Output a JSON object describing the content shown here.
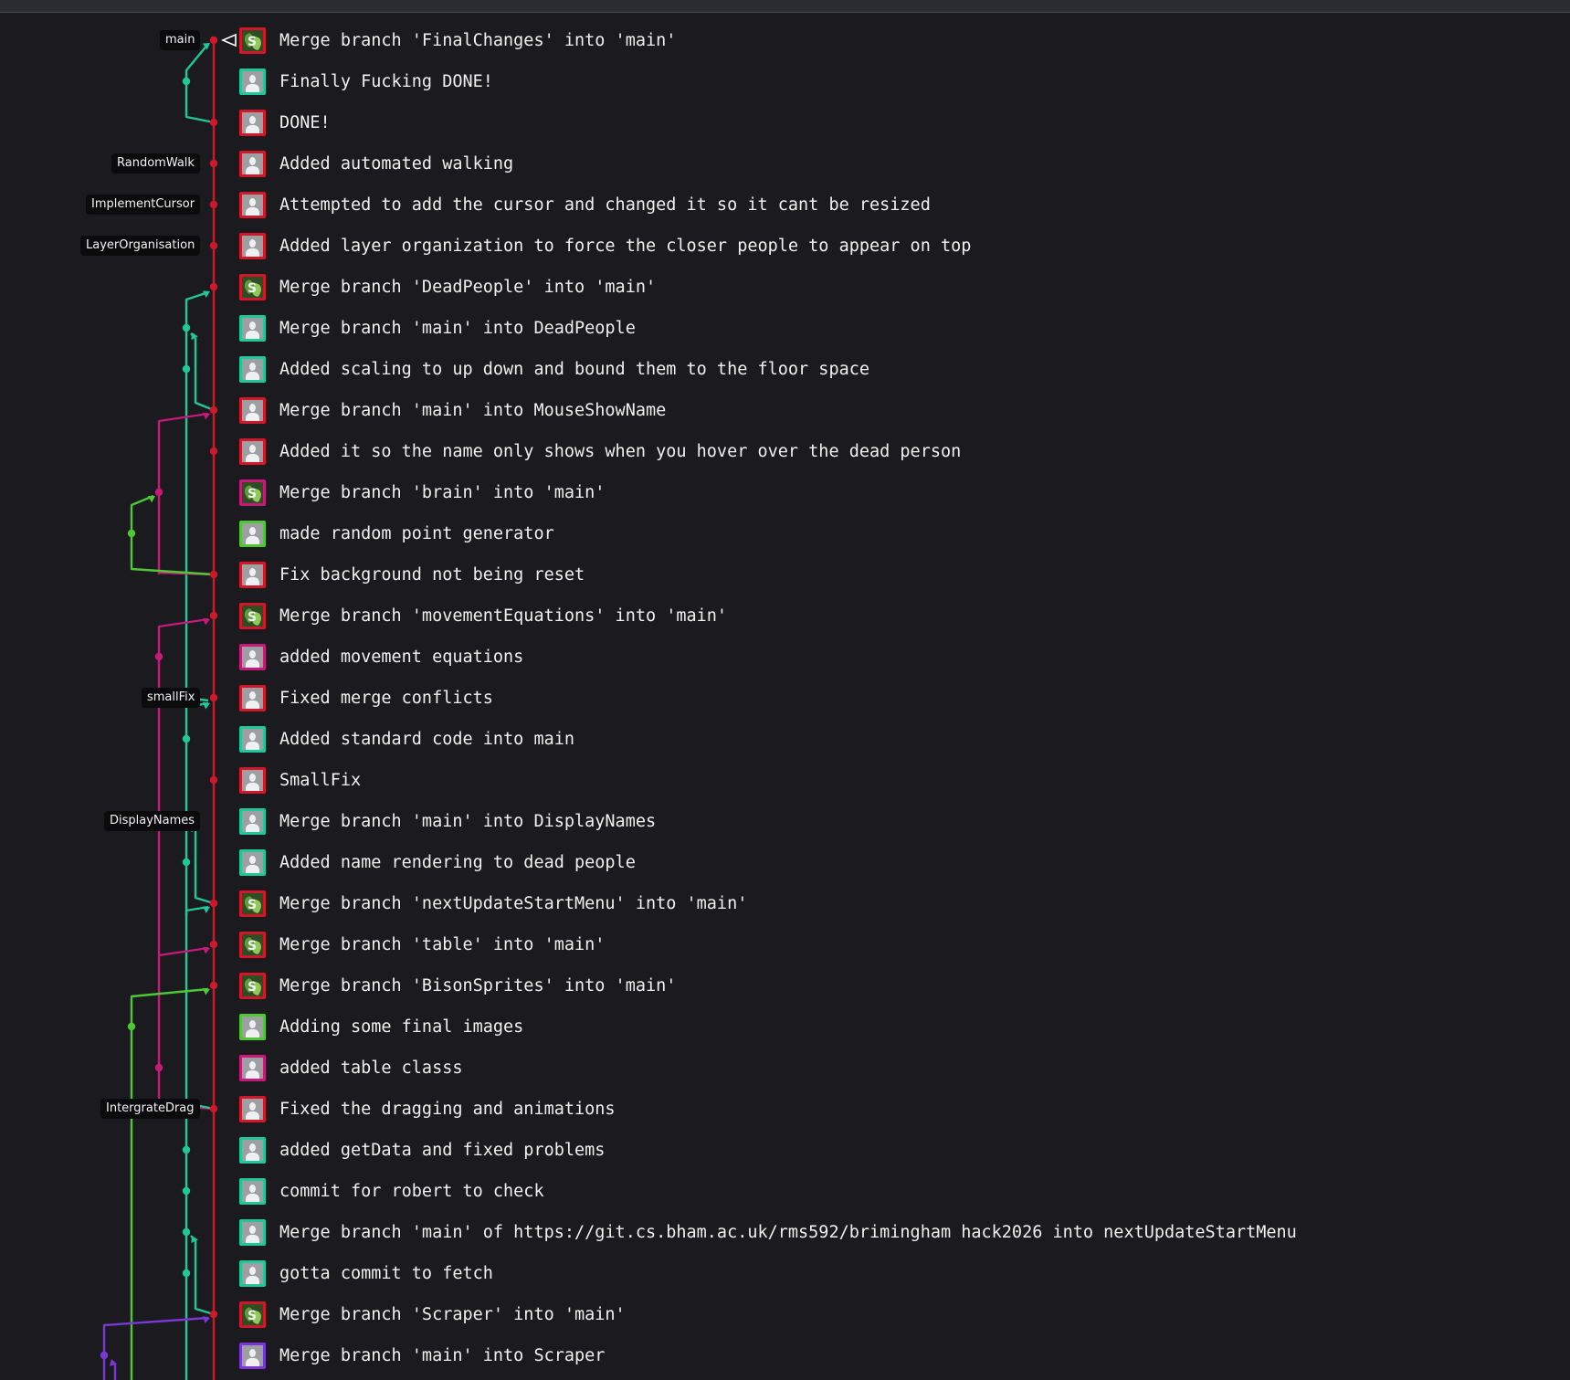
{
  "colors": {
    "main": "#d0182a",
    "teal": "#1fc799",
    "magenta": "#c51a7a",
    "lime": "#4fc734",
    "purple": "#7a36d6"
  },
  "branch_labels": [
    {
      "text": "main",
      "row": 0
    },
    {
      "text": "RandomWalk",
      "row": 3
    },
    {
      "text": "ImplementCursor",
      "row": 4
    },
    {
      "text": "LayerOrganisation",
      "row": 5
    },
    {
      "text": "smallFix",
      "row": 16
    },
    {
      "text": "DisplayNames",
      "row": 19
    },
    {
      "text": "IntergrateDrag",
      "row": 26
    }
  ],
  "commits": [
    {
      "message": "Merge branch 'FinalChanges' into 'main'",
      "avatar": "photo",
      "border": "main"
    },
    {
      "message": "Finally Fucking DONE!",
      "avatar": "default",
      "border": "teal"
    },
    {
      "message": "DONE!",
      "avatar": "default",
      "border": "main"
    },
    {
      "message": "Added automated walking",
      "avatar": "default",
      "border": "main"
    },
    {
      "message": "Attempted to add the cursor and changed it so it cant be resized",
      "avatar": "default",
      "border": "main"
    },
    {
      "message": "Added layer organization to force the closer people to appear on top",
      "avatar": "default",
      "border": "main"
    },
    {
      "message": "Merge branch 'DeadPeople' into 'main'",
      "avatar": "photo",
      "border": "main"
    },
    {
      "message": "Merge branch 'main' into DeadPeople",
      "avatar": "default",
      "border": "teal"
    },
    {
      "message": "Added scaling to up down and bound them to the floor space",
      "avatar": "default",
      "border": "teal"
    },
    {
      "message": "Merge branch 'main' into MouseShowName",
      "avatar": "default",
      "border": "main"
    },
    {
      "message": "Added it so the name only shows when you hover over the dead person",
      "avatar": "default",
      "border": "main"
    },
    {
      "message": "Merge branch 'brain' into 'main'",
      "avatar": "photo",
      "border": "magenta"
    },
    {
      "message": "made random point generator",
      "avatar": "default",
      "border": "lime"
    },
    {
      "message": "Fix background not being reset",
      "avatar": "default",
      "border": "main"
    },
    {
      "message": "Merge branch 'movementEquations' into 'main'",
      "avatar": "photo",
      "border": "main"
    },
    {
      "message": "added movement equations",
      "avatar": "default",
      "border": "magenta"
    },
    {
      "message": "Fixed merge conflicts",
      "avatar": "default",
      "border": "main"
    },
    {
      "message": "Added standard code into main",
      "avatar": "default",
      "border": "teal"
    },
    {
      "message": "SmallFix",
      "avatar": "default",
      "border": "main"
    },
    {
      "message": "Merge branch 'main' into DisplayNames",
      "avatar": "default",
      "border": "teal"
    },
    {
      "message": "Added name rendering to dead people",
      "avatar": "default",
      "border": "teal"
    },
    {
      "message": "Merge branch 'nextUpdateStartMenu' into 'main'",
      "avatar": "photo",
      "border": "main"
    },
    {
      "message": "Merge branch 'table' into 'main'",
      "avatar": "photo",
      "border": "main"
    },
    {
      "message": "Merge branch 'BisonSprites' into 'main'",
      "avatar": "photo",
      "border": "main"
    },
    {
      "message": "Adding some final images",
      "avatar": "default",
      "border": "lime"
    },
    {
      "message": "added table classs",
      "avatar": "default",
      "border": "magenta"
    },
    {
      "message": "Fixed the dragging and animations",
      "avatar": "default",
      "border": "main"
    },
    {
      "message": "added getData and fixed problems",
      "avatar": "default",
      "border": "teal"
    },
    {
      "message": "commit for robert to check",
      "avatar": "default",
      "border": "teal"
    },
    {
      "message": "Merge branch 'main' of https://git.cs.bham.ac.uk/rms592/brimingham hack2026 into nextUpdateStartMenu",
      "avatar": "default",
      "border": "teal"
    },
    {
      "message": "gotta commit to fetch",
      "avatar": "default",
      "border": "teal"
    },
    {
      "message": "Merge branch 'Scraper' into 'main'",
      "avatar": "photo",
      "border": "main"
    },
    {
      "message": "Merge branch 'main' into Scraper",
      "avatar": "default",
      "border": "purple"
    }
  ]
}
